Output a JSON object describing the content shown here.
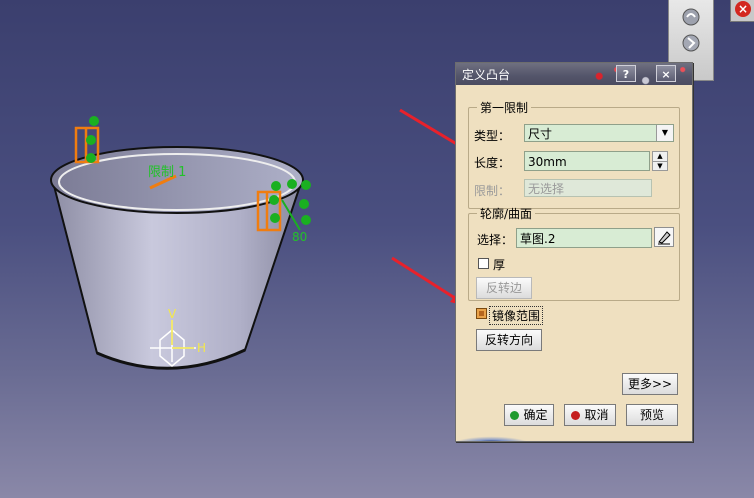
{
  "viewport": {
    "labels": {
      "limit_label": "限制 1",
      "axis_v": "V",
      "axis_h": "H",
      "dim_value": "80"
    }
  },
  "toolbar": {
    "icons": [
      "hand-gear-icon",
      "pointer-gear-icon"
    ],
    "close_icon": "close-icon"
  },
  "dialog": {
    "title": "定义凸台",
    "help_label": "?",
    "close_label": "×",
    "first_limit": {
      "legend": "第一限制",
      "type_label": "类型：",
      "type_value": "尺寸",
      "length_label": "长度：",
      "length_value": "30mm",
      "limit_label": "限制：",
      "limit_placeholder": "无选择"
    },
    "profile": {
      "legend": "轮廓/曲面",
      "select_label": "选择：",
      "select_value": "草图.2",
      "thick_label": "厚",
      "thick_checked": false,
      "reverse_side_label": "反转边"
    },
    "mirror_label": "镜像范围",
    "mirror_checked": true,
    "reverse_dir_label": "反转方向",
    "more_label": "更多>>",
    "ok_label": "确定",
    "cancel_label": "取消",
    "preview_label": "预览",
    "colors": {
      "ok_dot": "#1e9a2e",
      "cancel_dot": "#c51f1f",
      "arrow": "#e8212b"
    }
  }
}
